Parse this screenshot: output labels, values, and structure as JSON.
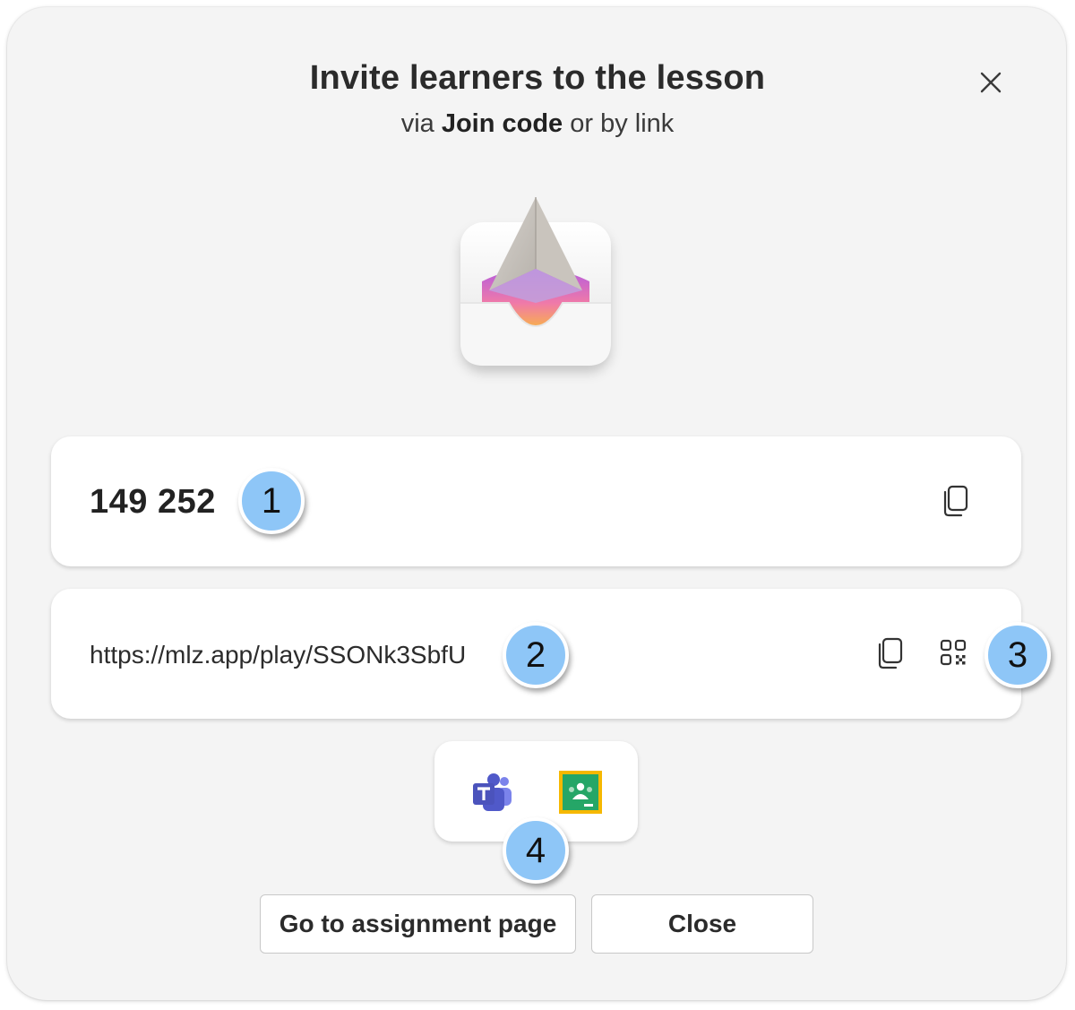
{
  "dialog": {
    "title": "Invite learners to the lesson",
    "subtitle": {
      "prefix": "via",
      "emphasis": "Join code",
      "suffix": "or by link"
    },
    "close_icon": "close-icon",
    "logo_icon": "paper-plane-tray-logo"
  },
  "join_code": {
    "value": "149 252",
    "copy_icon": "copy-icon"
  },
  "link": {
    "url": "https://mlz.app/play/SSONk3SbfU",
    "copy_icon": "copy-icon",
    "qr_icon": "qr-code-icon"
  },
  "share": {
    "apps": [
      {
        "name": "Microsoft Teams",
        "icon": "teams-icon",
        "color": "#5059c9"
      },
      {
        "name": "Google Classroom",
        "icon": "google-classroom-icon",
        "color": "#25a667"
      }
    ]
  },
  "callouts": [
    "1",
    "2",
    "3",
    "4"
  ],
  "buttons": {
    "assignment_label": "Go to assignment page",
    "close_label": "Close"
  },
  "colors": {
    "dialog_bg": "#f4f4f4",
    "badge": "#8ec6f7",
    "text": "#2b2b2b"
  }
}
